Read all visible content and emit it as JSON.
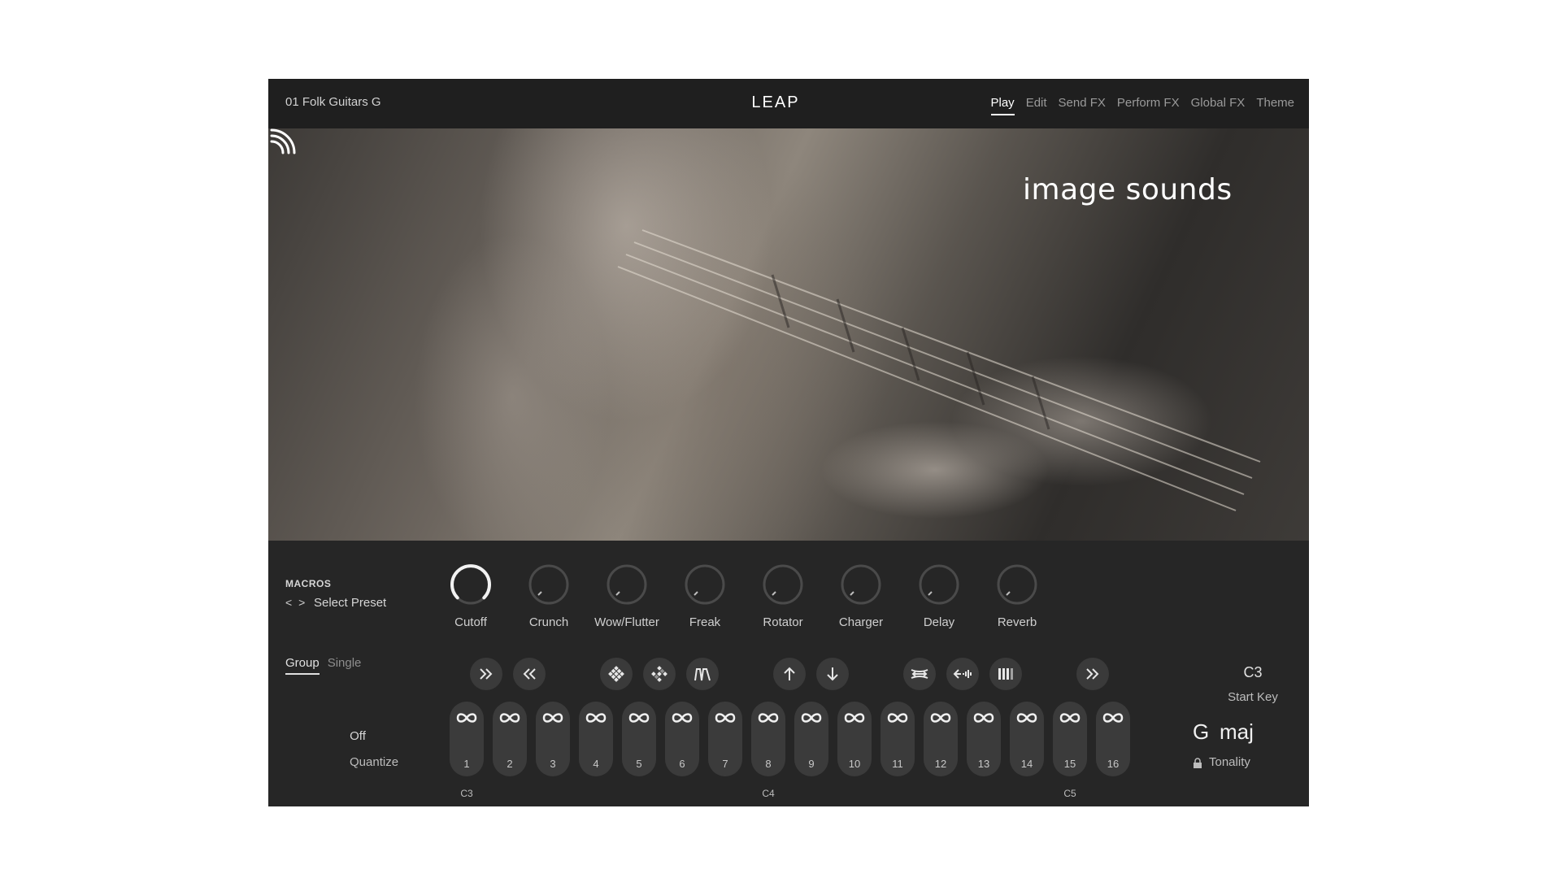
{
  "header": {
    "preset_name": "01 Folk Guitars G",
    "logo_text": "LEAP",
    "tabs": [
      {
        "label": "Play",
        "active": true
      },
      {
        "label": "Edit"
      },
      {
        "label": "Send FX"
      },
      {
        "label": "Perform FX"
      },
      {
        "label": "Global FX"
      },
      {
        "label": "Theme"
      }
    ]
  },
  "hero": {
    "brand": "image sounds",
    "brand_icon": "signal-waves-icon"
  },
  "macros": {
    "label": "MACROS",
    "arrows": "< >",
    "select_preset": "Select Preset",
    "knobs": [
      {
        "label": "Cutoff",
        "level": 0.9
      },
      {
        "label": "Crunch",
        "level": 0.0
      },
      {
        "label": "Wow/Flutter",
        "level": 0.0
      },
      {
        "label": "Freak",
        "level": 0.0
      },
      {
        "label": "Rotator",
        "level": 0.0
      },
      {
        "label": "Charger",
        "level": 0.0
      },
      {
        "label": "Delay",
        "level": 0.0
      },
      {
        "label": "Reverb",
        "level": 0.0
      }
    ]
  },
  "mode_tabs": [
    {
      "label": "Group",
      "active": true
    },
    {
      "label": "Single"
    }
  ],
  "quantize": {
    "value": "Off",
    "label": "Quantize"
  },
  "toolbar_icons": [
    "fast-forward-icon",
    "rewind-icon",
    "diamond-grid-icon",
    "diamond-grid-alt-icon",
    "waveform-icon",
    "arrow-up-icon",
    "arrow-down-icon",
    "stretch-icon",
    "reverse-icon",
    "bars-icon",
    "skip-forward-icon"
  ],
  "pads": [
    {
      "number": "1"
    },
    {
      "number": "2"
    },
    {
      "number": "3"
    },
    {
      "number": "4"
    },
    {
      "number": "5"
    },
    {
      "number": "6"
    },
    {
      "number": "7"
    },
    {
      "number": "8"
    },
    {
      "number": "9"
    },
    {
      "number": "10"
    },
    {
      "number": "11"
    },
    {
      "number": "12"
    },
    {
      "number": "13"
    },
    {
      "number": "14"
    },
    {
      "number": "15"
    },
    {
      "number": "16"
    }
  ],
  "octaves": [
    "C3",
    "C4",
    "C5"
  ],
  "start_key": {
    "value": "C3",
    "label": "Start Key"
  },
  "tonality": {
    "key": "G",
    "mode": "maj",
    "label": "Tonality"
  },
  "colors": {
    "panel": "#262626",
    "pad": "#3b3b3b",
    "accent": "#ffffff"
  }
}
